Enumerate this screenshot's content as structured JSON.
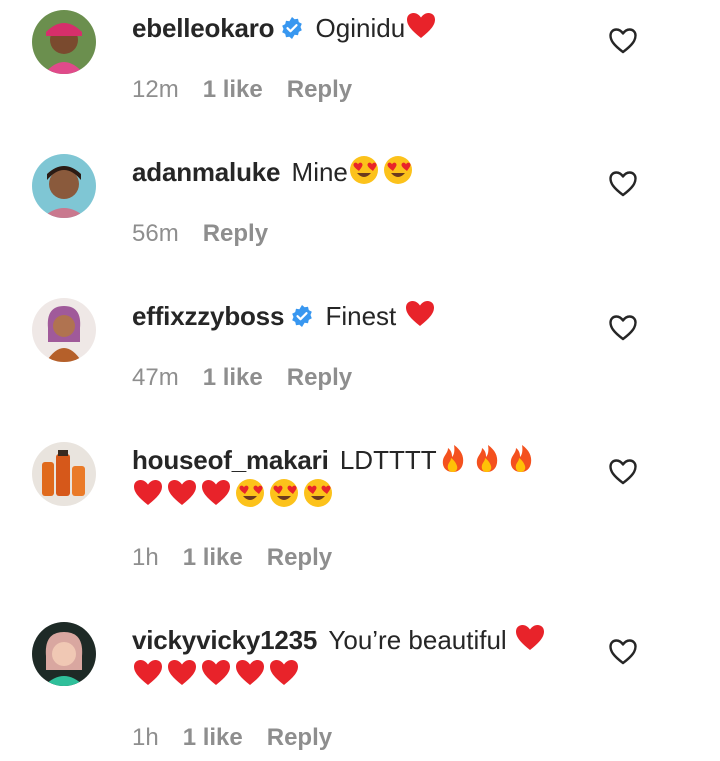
{
  "comments": [
    {
      "username": "ebelleokaro",
      "verified": true,
      "text": "Oginidu",
      "emojis_line1": [
        "red-heart"
      ],
      "emojis_line2": [],
      "time": "12m",
      "likes": "1 like",
      "reply": "Reply"
    },
    {
      "username": "adanmaluke",
      "verified": false,
      "text": "Mine",
      "emojis_line1": [
        "heart-eyes",
        "heart-eyes"
      ],
      "emojis_line2": [],
      "time": "56m",
      "likes": "",
      "reply": "Reply"
    },
    {
      "username": "effixzzyboss",
      "verified": true,
      "text": "Finest",
      "emojis_line1": [
        "red-heart"
      ],
      "emojis_line2": [],
      "time": "47m",
      "likes": "1 like",
      "reply": "Reply"
    },
    {
      "username": "houseof_makari",
      "verified": false,
      "text": "LDTTTT",
      "emojis_line1": [
        "fire",
        "fire",
        "fire"
      ],
      "emojis_line2": [
        "red-heart",
        "red-heart",
        "red-heart",
        "heart-eyes",
        "heart-eyes",
        "heart-eyes"
      ],
      "time": "1h",
      "likes": "1 like",
      "reply": "Reply"
    },
    {
      "username": "vickyvicky1235",
      "verified": false,
      "text": "You’re beautiful",
      "emojis_line1": [
        "red-heart"
      ],
      "emojis_line2": [
        "red-heart",
        "red-heart",
        "red-heart",
        "red-heart",
        "red-heart"
      ],
      "time": "1h",
      "likes": "1 like",
      "reply": "Reply"
    }
  ],
  "icons": {
    "like": "heart-outline-icon",
    "verified": "verified-badge-icon"
  },
  "colors": {
    "text": "#262626",
    "meta": "#8e8e8e",
    "verified": "#3897f0",
    "heart": "#e0245e"
  }
}
